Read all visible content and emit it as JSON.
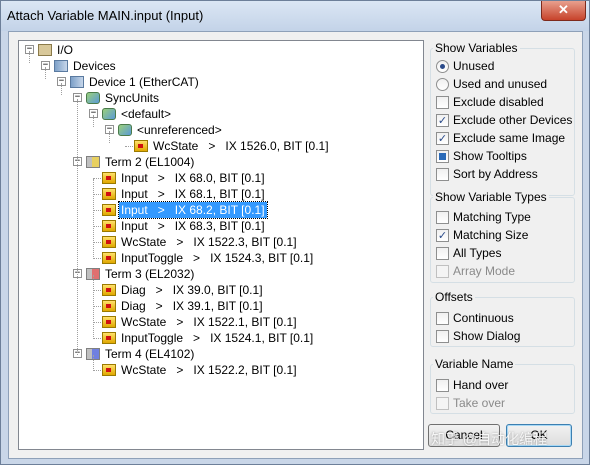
{
  "window": {
    "title": "Attach Variable MAIN.input (Input)",
    "close_label": "✕"
  },
  "tree": [
    {
      "label": "I/O",
      "icon": "io-icon",
      "exp": "-"
    },
    {
      "label": "Devices",
      "icon": "devices-icon",
      "exp": "-"
    },
    {
      "label": "Device 1 (EtherCAT)",
      "icon": "device-icon",
      "exp": "-"
    },
    {
      "label": "SyncUnits",
      "icon": "syncunits-icon",
      "exp": "-"
    },
    {
      "label": "<default>",
      "icon": "syncunit-icon",
      "exp": "-"
    },
    {
      "label": "<unreferenced>",
      "icon": "syncunit-icon",
      "exp": "-"
    },
    {
      "label": "WcState   >   IX 1526.0, BIT [0.1]",
      "icon": "input-var-icon",
      "exp": ""
    },
    {
      "label": "Term 2 (EL1004)",
      "icon": "terminal-icon",
      "exp": "-"
    },
    {
      "label": "Input   >   IX 68.0, BIT [0.1]",
      "icon": "input-var-icon",
      "exp": ""
    },
    {
      "label": "Input   >   IX 68.1, BIT [0.1]",
      "icon": "input-var-icon",
      "exp": ""
    },
    {
      "label": "Input   >   IX 68.2, BIT [0.1]",
      "icon": "input-var-icon",
      "exp": "",
      "selected": true
    },
    {
      "label": "Input   >   IX 68.3, BIT [0.1]",
      "icon": "input-var-icon",
      "exp": ""
    },
    {
      "label": "WcState   >   IX 1522.3, BIT [0.1]",
      "icon": "input-var-icon",
      "exp": ""
    },
    {
      "label": "InputToggle   >   IX 1524.3, BIT [0.1]",
      "icon": "input-var-icon",
      "exp": ""
    },
    {
      "label": "Term 3 (EL2032)",
      "icon": "terminal-icon",
      "exp": "-"
    },
    {
      "label": "Diag   >   IX 39.0, BIT [0.1]",
      "icon": "input-var-icon",
      "exp": ""
    },
    {
      "label": "Diag   >   IX 39.1, BIT [0.1]",
      "icon": "input-var-icon",
      "exp": ""
    },
    {
      "label": "WcState   >   IX 1522.1, BIT [0.1]",
      "icon": "input-var-icon",
      "exp": ""
    },
    {
      "label": "InputToggle   >   IX 1524.1, BIT [0.1]",
      "icon": "input-var-icon",
      "exp": ""
    },
    {
      "label": "Term 4 (EL4102)",
      "icon": "terminal-icon",
      "exp": "-"
    },
    {
      "label": "WcState   >   IX 1522.2, BIT [0.1]",
      "icon": "input-var-icon",
      "exp": ""
    }
  ],
  "show_variables": {
    "title": "Show Variables",
    "unused": {
      "label": "Unused",
      "checked": true
    },
    "used_and_unused": {
      "label": "Used and unused",
      "checked": false
    },
    "exclude_disabled": {
      "label": "Exclude disabled",
      "checked": false
    },
    "exclude_other_devices": {
      "label": "Exclude other Devices",
      "checked": true
    },
    "exclude_same_image": {
      "label": "Exclude same Image",
      "checked": true
    },
    "show_tooltips": {
      "label": "Show Tooltips",
      "checked": "indeterminate"
    },
    "sort_by_address": {
      "label": "Sort by Address",
      "checked": false
    }
  },
  "show_variable_types": {
    "title": "Show Variable Types",
    "matching_type": {
      "label": "Matching Type",
      "checked": false
    },
    "matching_size": {
      "label": "Matching Size",
      "checked": true
    },
    "all_types": {
      "label": "All Types",
      "checked": false
    },
    "array_mode": {
      "label": "Array Mode",
      "checked": false,
      "disabled": true
    }
  },
  "offsets": {
    "title": "Offsets",
    "continuous": {
      "label": "Continuous",
      "checked": false
    },
    "show_dialog": {
      "label": "Show Dialog",
      "checked": false
    }
  },
  "variable_name": {
    "title": "Variable Name",
    "hand_over": {
      "label": "Hand over",
      "checked": false
    },
    "take_over": {
      "label": "Take over",
      "checked": false,
      "disabled": true
    }
  },
  "buttons": {
    "cancel": "Cancel",
    "ok": "OK"
  },
  "watermark": "知乎 @自动化编程"
}
